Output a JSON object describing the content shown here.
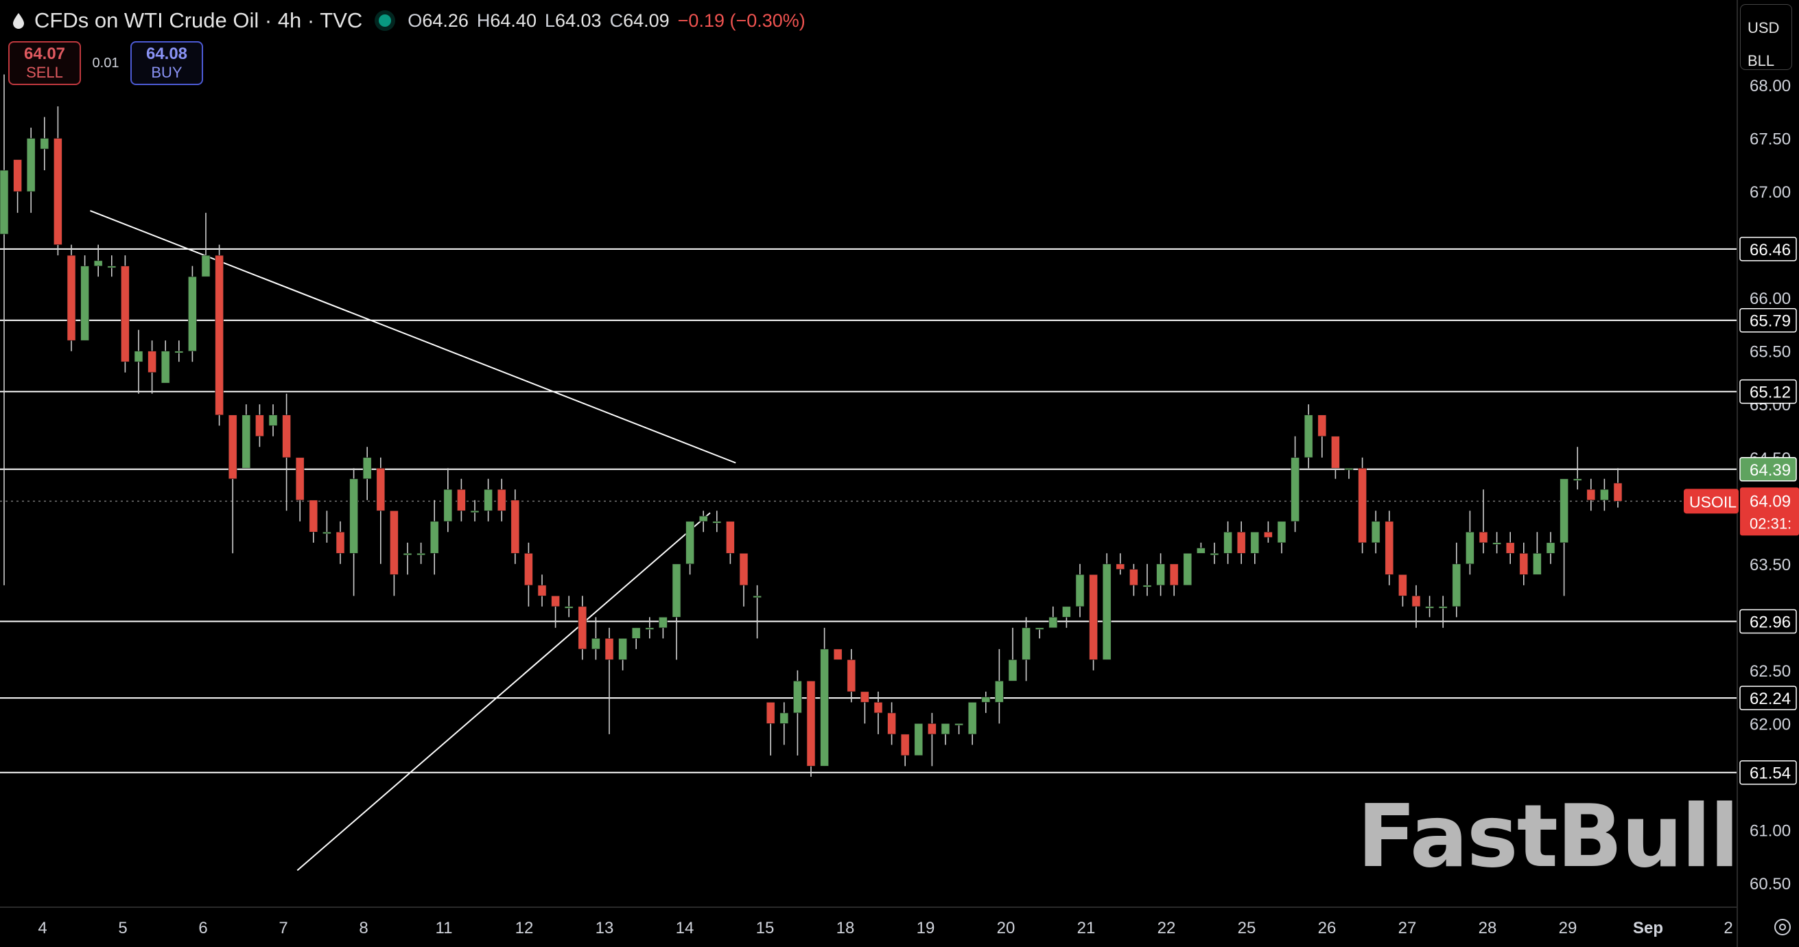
{
  "header": {
    "title": "CFDs on WTI Crude Oil · 4h · TVC",
    "ohlc": [
      {
        "label": "O",
        "value": "64.26"
      },
      {
        "label": "H",
        "value": "64.40"
      },
      {
        "label": "L",
        "value": "64.03"
      },
      {
        "label": "C",
        "value": "64.09"
      }
    ],
    "change": "−0.19 (−0.30%)",
    "change_color": "#ef5350"
  },
  "trade": {
    "sell_price": "64.07",
    "sell_label": "SELL",
    "spread": "0.01",
    "buy_price": "64.08",
    "buy_label": "BUY"
  },
  "currency": {
    "top": "USD",
    "bottom": "BLL"
  },
  "watermark": "FastBull",
  "colors": {
    "up": "#5fa35f",
    "down": "#e04a3f",
    "background": "#000000",
    "line": "#ffffff",
    "symbol_tag": "#e53935"
  },
  "chart_data": {
    "type": "candlestick",
    "symbol": "USOIL",
    "last_price": "64.09",
    "countdown": "02:31:",
    "highlight_level": "64.39",
    "ylim": [
      60.3,
      68.8
    ],
    "y_ticks": [
      "68.00",
      "67.50",
      "67.00",
      "66.00",
      "65.50",
      "65.00",
      "64.50",
      "63.50",
      "62.50",
      "62.00",
      "61.00",
      "60.50"
    ],
    "x_labels": [
      "4",
      "5",
      "6",
      "7",
      "8",
      "11",
      "12",
      "13",
      "14",
      "15",
      "18",
      "19",
      "20",
      "21",
      "22",
      "25",
      "26",
      "27",
      "28",
      "29",
      "Sep",
      "2"
    ],
    "horizontal_levels": [
      "66.46",
      "65.79",
      "65.12",
      "64.39",
      "62.96",
      "62.24",
      "61.54"
    ],
    "trendlines": [
      {
        "from": [
          6.4,
          66.82
        ],
        "to": [
          54.4,
          64.45
        ]
      },
      {
        "from": [
          21.8,
          60.62
        ],
        "to": [
          52.5,
          63.98
        ]
      }
    ],
    "candles": [
      [
        66.6,
        67.2,
        68.1,
        63.3
      ],
      [
        67.3,
        67.0,
        67.2,
        66.8
      ],
      [
        67.0,
        67.5,
        67.6,
        66.8
      ],
      [
        67.4,
        67.5,
        67.7,
        67.2
      ],
      [
        67.5,
        66.5,
        67.8,
        66.4
      ],
      [
        66.4,
        65.6,
        66.5,
        65.5
      ],
      [
        65.6,
        66.3,
        66.4,
        65.7
      ],
      [
        66.3,
        66.35,
        66.5,
        66.2
      ],
      [
        66.3,
        66.3,
        66.4,
        66.2
      ],
      [
        66.3,
        65.4,
        66.4,
        65.3
      ],
      [
        65.4,
        65.5,
        65.7,
        65.1
      ],
      [
        65.5,
        65.3,
        65.6,
        65.1
      ],
      [
        65.2,
        65.5,
        65.6,
        65.2
      ],
      [
        65.5,
        65.5,
        65.6,
        65.4
      ],
      [
        65.5,
        66.2,
        66.3,
        65.4
      ],
      [
        66.2,
        66.4,
        66.8,
        66.3
      ],
      [
        66.4,
        64.9,
        66.5,
        64.8
      ],
      [
        64.9,
        64.3,
        64.9,
        63.6
      ],
      [
        64.4,
        64.9,
        65.0,
        64.4
      ],
      [
        64.9,
        64.7,
        65.0,
        64.6
      ],
      [
        64.8,
        64.9,
        65.0,
        64.7
      ],
      [
        64.9,
        64.5,
        65.1,
        64.0
      ],
      [
        64.5,
        64.1,
        64.5,
        63.9
      ],
      [
        64.1,
        63.8,
        64.1,
        63.7
      ],
      [
        63.8,
        63.8,
        64.0,
        63.7
      ],
      [
        63.8,
        63.6,
        63.9,
        63.5
      ],
      [
        63.6,
        64.3,
        64.4,
        63.2
      ],
      [
        64.3,
        64.5,
        64.6,
        64.1
      ],
      [
        64.4,
        64.0,
        64.5,
        63.5
      ],
      [
        64.0,
        63.4,
        64.0,
        63.2
      ],
      [
        63.6,
        63.6,
        63.7,
        63.4
      ],
      [
        63.6,
        63.6,
        63.7,
        63.5
      ],
      [
        63.6,
        63.9,
        64.1,
        63.4
      ],
      [
        63.9,
        64.2,
        64.4,
        63.8
      ],
      [
        64.2,
        64.0,
        64.3,
        63.9
      ],
      [
        64.0,
        64.0,
        64.1,
        63.9
      ],
      [
        64.0,
        64.2,
        64.3,
        63.9
      ],
      [
        64.2,
        64.0,
        64.3,
        63.9
      ],
      [
        64.1,
        63.6,
        64.2,
        63.5
      ],
      [
        63.6,
        63.3,
        63.7,
        63.1
      ],
      [
        63.3,
        63.2,
        63.4,
        63.1
      ],
      [
        63.2,
        63.1,
        63.2,
        62.9
      ],
      [
        63.1,
        63.1,
        63.2,
        63.0
      ],
      [
        63.1,
        62.7,
        63.2,
        62.6
      ],
      [
        62.7,
        62.8,
        63.0,
        62.6
      ],
      [
        62.8,
        62.6,
        62.9,
        61.9
      ],
      [
        62.6,
        62.8,
        62.8,
        62.5
      ],
      [
        62.8,
        62.9,
        62.9,
        62.7
      ],
      [
        62.9,
        62.9,
        63.0,
        62.8
      ],
      [
        62.9,
        63.0,
        63.0,
        62.8
      ],
      [
        63.0,
        63.5,
        63.5,
        62.6
      ],
      [
        63.5,
        63.9,
        63.9,
        63.4
      ],
      [
        63.9,
        63.95,
        64.0,
        63.8
      ],
      [
        63.9,
        63.9,
        64.0,
        63.8
      ],
      [
        63.9,
        63.6,
        63.9,
        63.5
      ],
      [
        63.6,
        63.3,
        63.6,
        63.1
      ],
      [
        63.2,
        63.2,
        63.3,
        62.8
      ],
      [
        62.2,
        62.0,
        62.2,
        61.7
      ],
      [
        62.0,
        62.1,
        62.2,
        61.8
      ],
      [
        62.1,
        62.4,
        62.5,
        61.7
      ],
      [
        62.4,
        61.6,
        62.4,
        61.5
      ],
      [
        61.6,
        62.7,
        62.9,
        61.6
      ],
      [
        62.7,
        62.6,
        62.7,
        62.6
      ],
      [
        62.6,
        62.3,
        62.7,
        62.2
      ],
      [
        62.3,
        62.2,
        62.3,
        62.0
      ],
      [
        62.2,
        62.1,
        62.3,
        61.9
      ],
      [
        62.1,
        61.9,
        62.2,
        61.8
      ],
      [
        61.9,
        61.7,
        61.9,
        61.6
      ],
      [
        61.7,
        62.0,
        62.0,
        61.7
      ],
      [
        62.0,
        61.9,
        62.1,
        61.6
      ],
      [
        61.9,
        62.0,
        62.0,
        61.8
      ],
      [
        62.0,
        62.0,
        62.0,
        61.9
      ],
      [
        61.9,
        62.2,
        62.2,
        61.8
      ],
      [
        62.2,
        62.25,
        62.3,
        62.1
      ],
      [
        62.2,
        62.4,
        62.7,
        62.0
      ],
      [
        62.4,
        62.6,
        62.9,
        62.4
      ],
      [
        62.6,
        62.9,
        63.0,
        62.4
      ],
      [
        62.9,
        62.9,
        62.9,
        62.8
      ],
      [
        62.9,
        63.0,
        63.1,
        62.9
      ],
      [
        63.0,
        63.1,
        63.1,
        62.9
      ],
      [
        63.1,
        63.4,
        63.5,
        63.0
      ],
      [
        63.4,
        62.6,
        63.4,
        62.5
      ],
      [
        62.6,
        63.5,
        63.6,
        62.6
      ],
      [
        63.5,
        63.45,
        63.6,
        63.4
      ],
      [
        63.45,
        63.3,
        63.5,
        63.2
      ],
      [
        63.3,
        63.3,
        63.5,
        63.2
      ],
      [
        63.3,
        63.5,
        63.6,
        63.2
      ],
      [
        63.5,
        63.3,
        63.5,
        63.2
      ],
      [
        63.3,
        63.6,
        63.6,
        63.3
      ],
      [
        63.6,
        63.65,
        63.7,
        63.6
      ],
      [
        63.6,
        63.6,
        63.7,
        63.5
      ],
      [
        63.6,
        63.8,
        63.9,
        63.5
      ],
      [
        63.8,
        63.6,
        63.9,
        63.5
      ],
      [
        63.6,
        63.8,
        63.8,
        63.5
      ],
      [
        63.8,
        63.75,
        63.9,
        63.7
      ],
      [
        63.7,
        63.9,
        63.9,
        63.6
      ],
      [
        63.9,
        64.5,
        64.7,
        63.8
      ],
      [
        64.5,
        64.9,
        65.0,
        64.4
      ],
      [
        64.9,
        64.7,
        64.9,
        64.5
      ],
      [
        64.7,
        64.4,
        64.7,
        64.3
      ],
      [
        64.4,
        64.4,
        64.4,
        64.3
      ],
      [
        64.4,
        63.7,
        64.5,
        63.6
      ],
      [
        63.7,
        63.9,
        64.0,
        63.6
      ],
      [
        63.9,
        63.4,
        64.0,
        63.3
      ],
      [
        63.4,
        63.2,
        63.4,
        63.1
      ],
      [
        63.2,
        63.1,
        63.3,
        62.9
      ],
      [
        63.1,
        63.1,
        63.2,
        63.0
      ],
      [
        63.1,
        63.1,
        63.2,
        62.9
      ],
      [
        63.1,
        63.5,
        63.7,
        63.0
      ],
      [
        63.5,
        63.8,
        64.0,
        63.4
      ],
      [
        63.8,
        63.7,
        64.2,
        63.6
      ],
      [
        63.7,
        63.7,
        63.8,
        63.6
      ],
      [
        63.7,
        63.6,
        63.8,
        63.5
      ],
      [
        63.6,
        63.4,
        63.7,
        63.3
      ],
      [
        63.4,
        63.6,
        63.8,
        63.4
      ],
      [
        63.6,
        63.7,
        63.8,
        63.5
      ],
      [
        63.7,
        64.3,
        64.3,
        63.2
      ],
      [
        64.3,
        64.3,
        64.6,
        64.2
      ],
      [
        64.2,
        64.1,
        64.3,
        64.0
      ],
      [
        64.1,
        64.2,
        64.3,
        64.0
      ],
      [
        64.26,
        64.09,
        64.4,
        64.03
      ]
    ]
  }
}
